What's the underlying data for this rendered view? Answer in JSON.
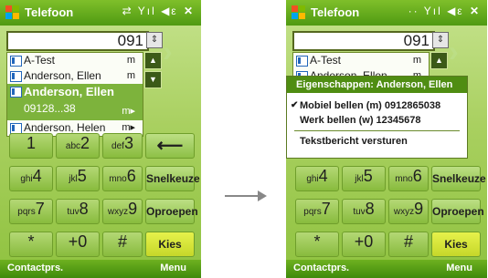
{
  "screens": [
    {
      "title": "Telefoon",
      "status_icons": "⇄ Yıl ◀ε",
      "close_label": "✕",
      "dial_number": "091",
      "contacts": [
        {
          "name": "A-Test",
          "type": "m"
        },
        {
          "name": "Anderson, Ellen",
          "type": "m"
        },
        {
          "name": "Anderson, Ellen",
          "number": "09128...38",
          "type": "m▸",
          "selected": true
        },
        {
          "name": "Anderson, Helen",
          "type": "m▸"
        }
      ],
      "keys": [
        {
          "main": "1",
          "sub": ""
        },
        {
          "main": "2",
          "sub": "abc"
        },
        {
          "main": "3",
          "sub": "def"
        },
        {
          "main": "4",
          "sub": "ghi"
        },
        {
          "main": "5",
          "sub": "jkl"
        },
        {
          "main": "6",
          "sub": "mno"
        },
        {
          "main": "7",
          "sub": "pqrs"
        },
        {
          "main": "8",
          "sub": "tuv"
        },
        {
          "main": "9",
          "sub": "wxyz"
        },
        {
          "main": "*",
          "sub": ""
        },
        {
          "main": "0",
          "sub": "+"
        },
        {
          "main": "#",
          "sub": ""
        }
      ],
      "backspace_label": "⟵",
      "speeddial_label": "Snelkeuze",
      "call_label": "Oproepen",
      "dial_label": "Kies",
      "softkey_left": "Contactprs.",
      "softkey_right": "Menu"
    }
  ],
  "right_screen": {
    "title": "Telefoon",
    "status_icons": "·· Yıl ◀ε",
    "close_label": "✕",
    "dial_number": "091",
    "contacts": [
      {
        "name": "A-Test",
        "type": "m"
      },
      {
        "name": "Anderson, Ellen",
        "type": "m"
      }
    ],
    "popup": {
      "header": "Eigenschappen: Anderson, Ellen",
      "items": [
        "Mobiel bellen (m) 0912865038",
        "Werk bellen (w) 12345678"
      ],
      "sms": "Tekstbericht versturen"
    },
    "speeddial_label": "Snelkeuze",
    "call_label": "Oproepen",
    "dial_label": "Kies",
    "softkey_left": "Contactprs.",
    "softkey_right": "Menu"
  },
  "colors": {
    "accent": "#4f9a12",
    "keypad": "#9ccc50",
    "kies": "#d8e63c"
  }
}
